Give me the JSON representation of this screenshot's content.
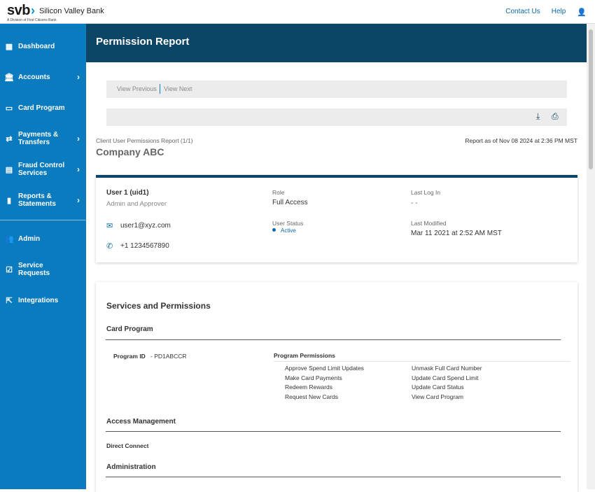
{
  "header": {
    "logo_text": "svb",
    "bank_name": "Silicon Valley Bank",
    "subtitle": "A Division of First Citizens Bank",
    "links": [
      "Contact Us",
      "Help"
    ]
  },
  "sidebar": {
    "items": [
      {
        "label": "Dashboard",
        "icon": "dashboard-icon",
        "glyph": "▦",
        "arrow": false
      },
      {
        "label": "Accounts",
        "icon": "bank-icon",
        "glyph": "🏛",
        "arrow": true
      },
      {
        "label": "Card Program",
        "icon": "card-icon",
        "glyph": "▭",
        "arrow": false
      },
      {
        "label": "Payments & Transfers",
        "icon": "transfer-icon",
        "glyph": "⇄",
        "arrow": true
      },
      {
        "label": "Fraud Control Services",
        "icon": "card-shield-icon",
        "glyph": "▤",
        "arrow": true
      },
      {
        "label": "Reports & Statements",
        "icon": "document-icon",
        "glyph": "▮",
        "arrow": true
      },
      {
        "label": "Admin",
        "icon": "people-icon",
        "glyph": "👥",
        "arrow": false
      },
      {
        "label": "Service Requests",
        "icon": "checkbox-icon",
        "glyph": "☑",
        "arrow": false
      },
      {
        "label": "Integrations",
        "icon": "integration-icon",
        "glyph": "⇱",
        "arrow": false
      }
    ]
  },
  "page": {
    "title": "Permission Report",
    "view_previous": "View Previous",
    "view_next": "View Next",
    "report_label": "Client User Permissions Report (1/1)",
    "report_date": "Report as of Nov 08 2024 at 2:36 PM MST",
    "company": "Company ABC"
  },
  "user": {
    "name": "User 1 (uid1)",
    "type": "Admin and Approver",
    "email": "user1@xyz.com",
    "phone": "+1 1234567890",
    "role_label": "Role",
    "role": "Full Access",
    "status_label": "User Status",
    "status": "Active",
    "last_login_label": "Last Log In",
    "last_login": "- -",
    "last_modified_label": "Last Modified",
    "last_modified": "Mar 11 2021 at 2:52 AM MST"
  },
  "services": {
    "title": "Services and Permissions",
    "card_program": "Card Program",
    "program_id_label": "Program ID",
    "program_id": "- PD1ABCCR",
    "permissions_label": "Program Permissions",
    "permissions": [
      "Approve Spend Limit Updates",
      "Make Card Payments",
      "Redeem Rewards",
      "Request New Cards",
      "Unmask Full Card Number",
      "Update Card Spend Limit",
      "Update Card Status",
      "View Card Program"
    ],
    "access_management": "Access Management",
    "direct_connect": "Direct Connect",
    "administration": "Administration"
  },
  "colors": {
    "sidebar": "#0a7bbf",
    "banner": "#0c4566",
    "active": "#0a7bbf"
  }
}
